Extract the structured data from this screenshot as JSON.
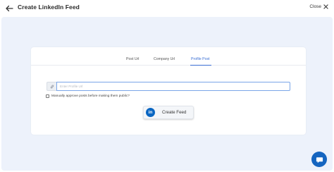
{
  "header": {
    "title": "Create LinkedIn Feed",
    "close_label": "Close"
  },
  "tabs": [
    {
      "label": "Post Url",
      "active": false
    },
    {
      "label": "Company Url",
      "active": false
    },
    {
      "label": "Profile Post",
      "active": true
    }
  ],
  "form": {
    "url_placeholder": "Enter Profile Url",
    "url_value": "",
    "approve_label": "Manually approve posts before making them public?",
    "approve_checked": false,
    "create_button_label": "Create Feed",
    "create_button_icon": "linkedin-icon",
    "linkedin_badge_text": "in"
  },
  "colors": {
    "accent": "#3b6fd4",
    "linkedin": "#0a66c2",
    "canvas_bg": "#edf2fb",
    "fab": "#1565c0"
  },
  "icons": {
    "back": "arrow-left-icon",
    "close": "close-x-icon",
    "input_prefix": "link-icon",
    "fab": "chat-icon"
  }
}
